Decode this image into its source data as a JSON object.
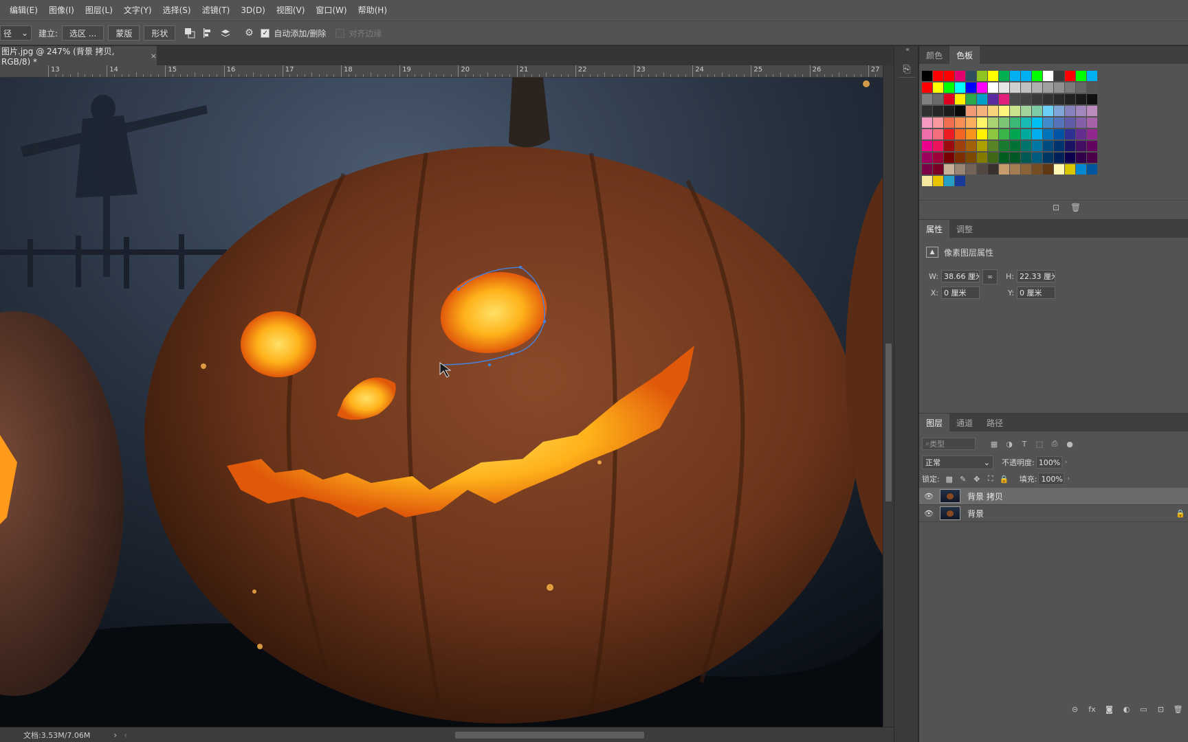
{
  "menu": [
    "编辑(E)",
    "图像(I)",
    "图层(L)",
    "文字(Y)",
    "选择(S)",
    "滤镜(T)",
    "3D(D)",
    "视图(V)",
    "窗口(W)",
    "帮助(H)"
  ],
  "options": {
    "mode_value": "径",
    "make_label": "建立:",
    "selection_button": "选区 ...",
    "mask_button": "蒙版",
    "shape_button": "形状",
    "auto_add_delete_label": "自动添加/删除",
    "align_edges_label": "对齐边缘"
  },
  "document_tab": {
    "title": "图片.jpg @ 247% (背景 拷贝, RGB/8) *",
    "close": "×"
  },
  "ruler_labels": [
    "13",
    "14",
    "15",
    "16",
    "17",
    "18",
    "19",
    "20",
    "21",
    "22",
    "23",
    "24",
    "25",
    "26",
    "27"
  ],
  "status": {
    "doc_size": "文档:3.53M/7.06M"
  },
  "swatches_panel": {
    "tabs": [
      "颜色",
      "色板"
    ],
    "active": 1
  },
  "properties_panel": {
    "tabs": [
      "属性",
      "调整"
    ],
    "heading": "像素图层属性",
    "w_label": "W:",
    "w_value": "38.66 厘米",
    "h_label": "H:",
    "h_value": "22.33 厘米",
    "x_label": "X:",
    "x_value": "0 厘米",
    "y_label": "Y:",
    "y_value": "0 厘米"
  },
  "layers_panel": {
    "tabs": [
      "图层",
      "通道",
      "路径"
    ],
    "filter_placeholder": "类型",
    "blend_mode": "正常",
    "opacity_label": "不透明度:",
    "opacity_value": "100%",
    "lock_label": "锁定:",
    "fill_label": "填充:",
    "fill_value": "100%",
    "layers": [
      {
        "name": "背景 拷贝",
        "visible": true,
        "active": true,
        "locked": false
      },
      {
        "name": "背景",
        "visible": true,
        "active": false,
        "locked": true
      }
    ]
  },
  "colors": {
    "ui_bg": "#535353",
    "canvas_bg": "#0e141c",
    "pumpkin": "#7a3d1c",
    "glow": "#ffb21a",
    "path": "#4a7fd4"
  }
}
